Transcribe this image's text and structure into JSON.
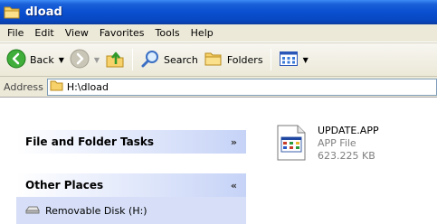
{
  "window": {
    "title": "dload"
  },
  "menu": {
    "items": [
      {
        "label": "File"
      },
      {
        "label": "Edit"
      },
      {
        "label": "View"
      },
      {
        "label": "Favorites"
      },
      {
        "label": "Tools"
      },
      {
        "label": "Help"
      }
    ]
  },
  "toolbar": {
    "back_label": "Back",
    "search_label": "Search",
    "folders_label": "Folders"
  },
  "address": {
    "label": "Address",
    "value": "H:\\dload"
  },
  "tasks": {
    "file_folder_tasks": "File and Folder Tasks",
    "other_places": "Other Places",
    "places": [
      {
        "label": "Removable Disk (H:)"
      }
    ]
  },
  "files": [
    {
      "name": "UPDATE.APP",
      "type": "APP File",
      "size": "623.225 KB"
    }
  ],
  "colors": {
    "titlebar": "#0a50d0",
    "chrome": "#ece9d8",
    "panel_body": "#d6dff7"
  }
}
